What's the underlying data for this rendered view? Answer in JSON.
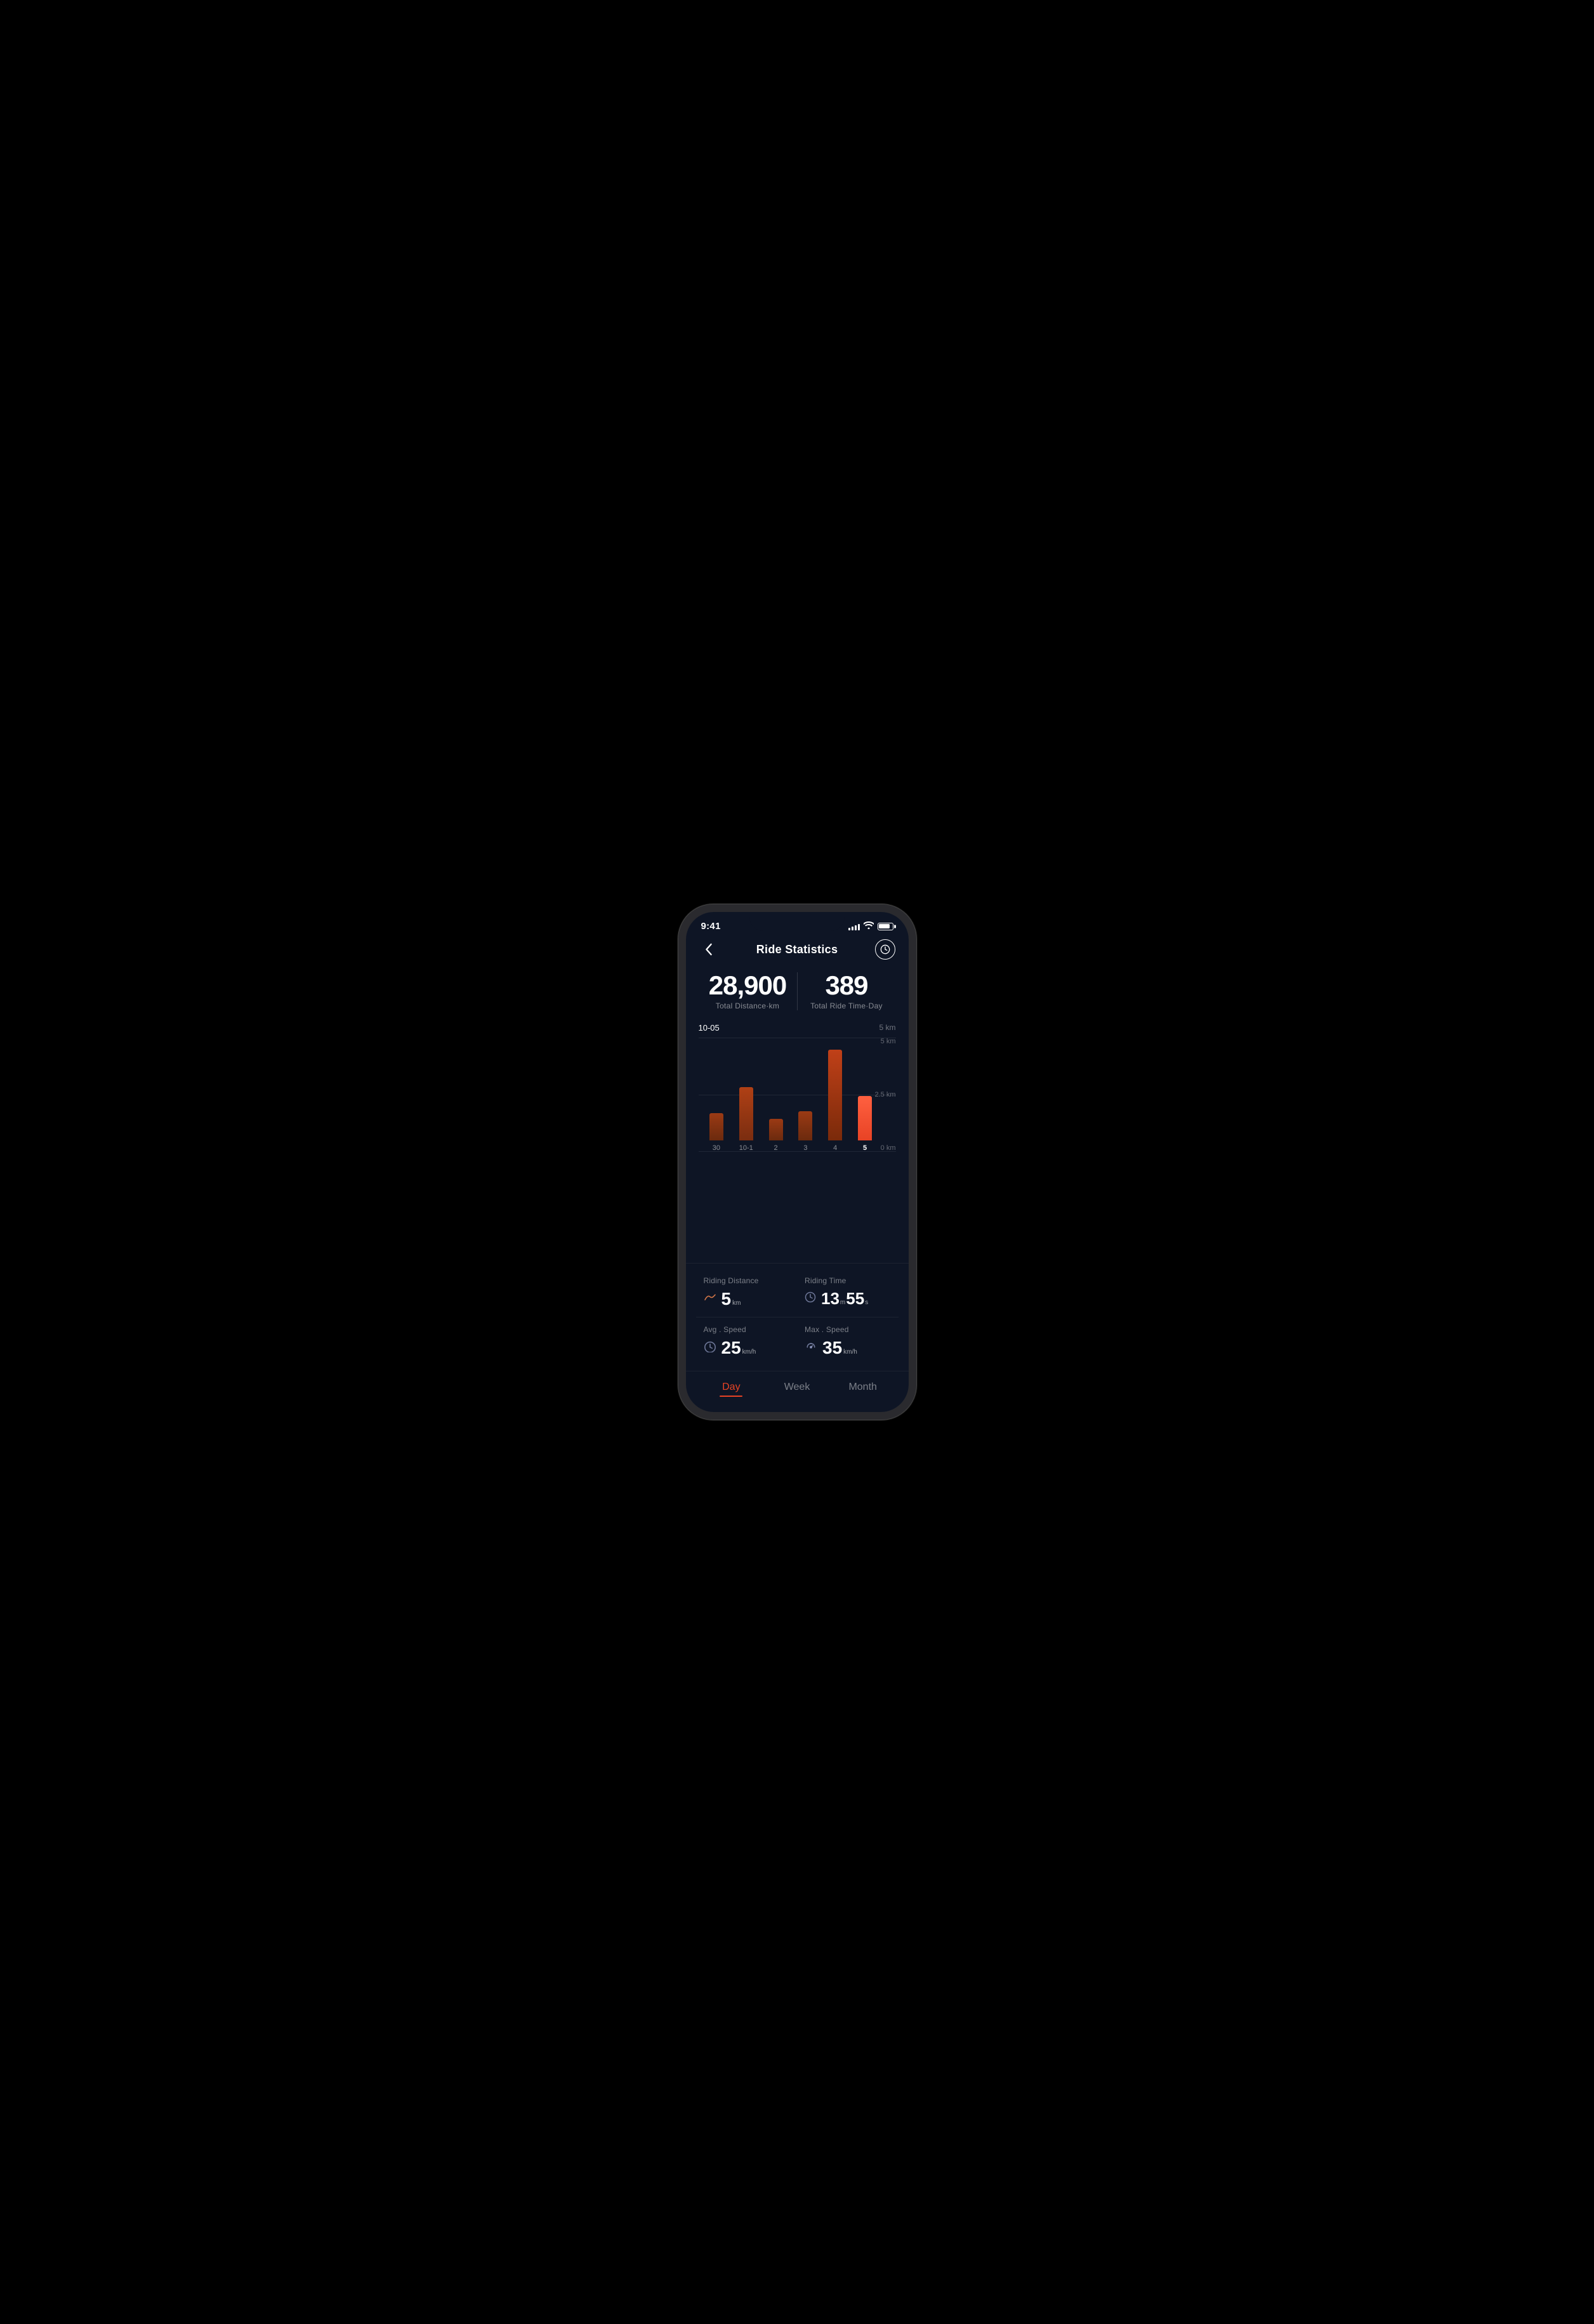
{
  "statusBar": {
    "time": "9:41",
    "signalBars": [
      3,
      5,
      7,
      9,
      11
    ],
    "batteryPercent": 85
  },
  "header": {
    "title": "Ride Statistics",
    "backLabel": "<",
    "historyLabel": "⏱"
  },
  "summaryStats": {
    "totalDistance": {
      "value": "28,900",
      "label": "Total Distance·km"
    },
    "totalRideTime": {
      "value": "389",
      "label": "Total Ride Time·Day"
    }
  },
  "chart": {
    "dateLabel": "10-05",
    "scaleTop": "5 km",
    "scaleMid": "2.5 km",
    "scaleBottom": "0 km",
    "bars": [
      {
        "label": "30",
        "height": 0.28,
        "active": false
      },
      {
        "label": "10-1",
        "height": 0.54,
        "active": false
      },
      {
        "label": "2",
        "height": 0.22,
        "active": false
      },
      {
        "label": "3",
        "height": 0.3,
        "active": false
      },
      {
        "label": "4",
        "height": 0.92,
        "active": false
      },
      {
        "label": "5",
        "height": 0.45,
        "active": true
      }
    ]
  },
  "rideStats": {
    "ridingDistance": {
      "label": "Riding Distance",
      "value": "5",
      "unit": "km"
    },
    "ridingTime": {
      "label": "Riding Time",
      "minutes": "13",
      "seconds": "55",
      "minuteUnit": "m",
      "secondUnit": "s"
    },
    "avgSpeed": {
      "label": "Avg . Speed",
      "value": "25",
      "unit": "km/h"
    },
    "maxSpeed": {
      "label": "Max . Speed",
      "value": "35",
      "unit": "km/h"
    }
  },
  "tabs": {
    "items": [
      {
        "label": "Day",
        "active": true
      },
      {
        "label": "Week",
        "active": false
      },
      {
        "label": "Month",
        "active": false
      }
    ]
  }
}
